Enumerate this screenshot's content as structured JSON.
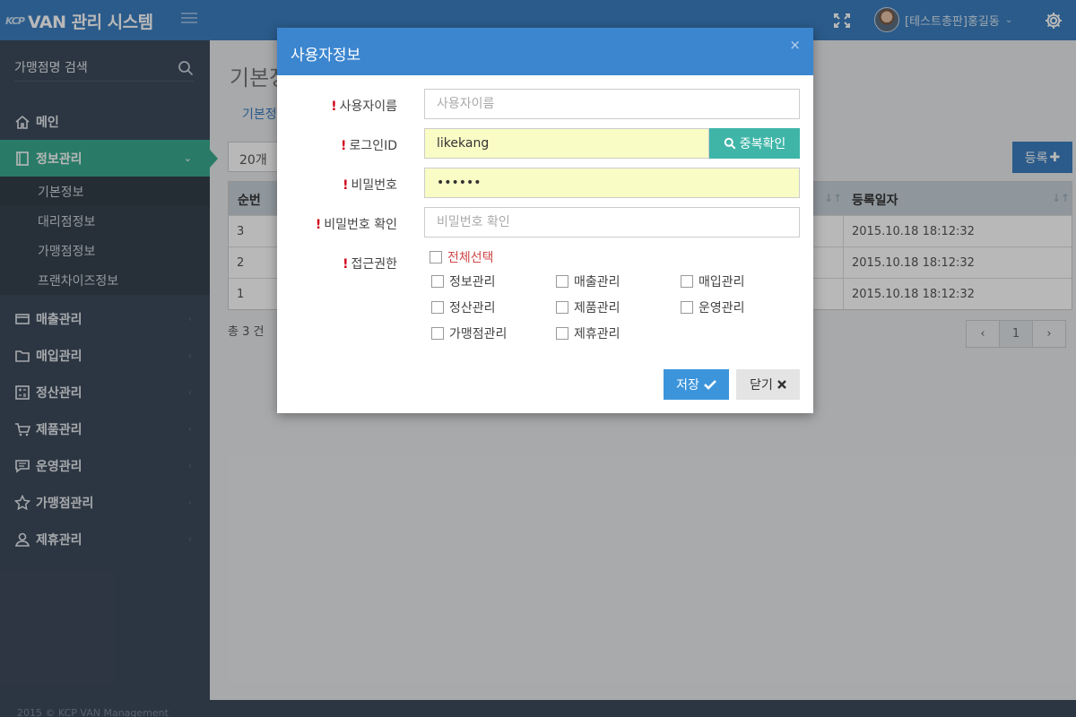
{
  "header": {
    "logo_small": "KCP",
    "app_title": "VAN 관리 시스템",
    "user_name": "[테스트총판]홍길동",
    "icons": [
      "menu-icon",
      "fullscreen-icon",
      "chevron-down-icon",
      "gear-icon"
    ]
  },
  "sidebar": {
    "search_placeholder": "가맹점명 검색",
    "menu": [
      {
        "label": "메인",
        "icon": "home-icon"
      },
      {
        "label": "정보관리",
        "icon": "book-icon"
      },
      {
        "label": "매출관리",
        "icon": "card-icon"
      },
      {
        "label": "매입관리",
        "icon": "folder-icon"
      },
      {
        "label": "정산관리",
        "icon": "calculator-icon"
      },
      {
        "label": "제품관리",
        "icon": "cart-icon"
      },
      {
        "label": "운영관리",
        "icon": "comment-icon"
      },
      {
        "label": "가맹점관리",
        "icon": "star-icon"
      },
      {
        "label": "제휴관리",
        "icon": "user-icon"
      }
    ],
    "submenu": [
      "기본정보",
      "대리점정보",
      "가맹점정보",
      "프랜차이즈정보"
    ]
  },
  "main": {
    "page_title": "기본정",
    "tab": "기본정",
    "per_page": "20개",
    "register_label": "등록",
    "columns": [
      "순번",
      "등록일자"
    ],
    "rows": [
      {
        "no": "3",
        "date": "2015.10.18 18:12:32"
      },
      {
        "no": "2",
        "date": "2015.10.18 18:12:32"
      },
      {
        "no": "1",
        "date": "2015.10.18 18:12:32"
      }
    ],
    "total": "총 3 건",
    "pagination": {
      "prev": "‹",
      "current": "1",
      "next": "›"
    }
  },
  "modal": {
    "title": "사용자정보",
    "close_symbol": "×",
    "fields": {
      "username": {
        "label": "사용자이름",
        "placeholder": "사용자이름",
        "value": ""
      },
      "login_id": {
        "label": "로그인ID",
        "value": "likekang"
      },
      "password": {
        "label": "비밀번호",
        "value": "••••••"
      },
      "password_confirm": {
        "label": "비밀번호 확인",
        "placeholder": "비밀번호 확인",
        "value": ""
      },
      "access": {
        "label": "접근권한"
      }
    },
    "dup_check_label": "중복확인",
    "select_all_label": "전체선택",
    "permissions": [
      "정보관리",
      "매출관리",
      "매입관리",
      "정산관리",
      "제품관리",
      "운영관리",
      "가맹점관리",
      "제휴관리"
    ],
    "save_label": "저장",
    "close_label": "닫기"
  },
  "footer": {
    "text": "2015 © KCP VAN Management"
  }
}
